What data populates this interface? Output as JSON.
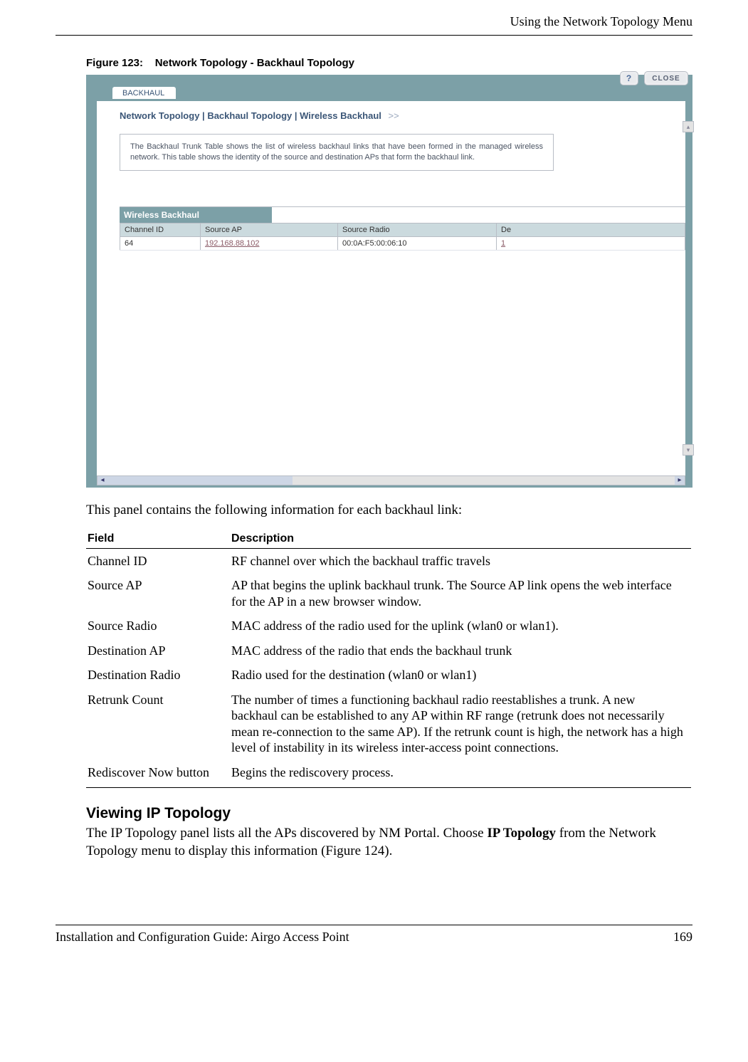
{
  "header": {
    "right_title": "Using the Network Topology Menu"
  },
  "figure": {
    "caption_label": "Figure 123:",
    "caption_text": "Network Topology - Backhaul Topology"
  },
  "screenshot": {
    "tab_label": "BACKHAUL",
    "help_label": "?",
    "close_label": "CLOSE",
    "breadcrumb_1": "Network Topology",
    "breadcrumb_2": "Backhaul Topology",
    "breadcrumb_3": "Wireless Backhaul",
    "breadcrumb_arrows": ">>",
    "intro_text": "The Backhaul Trunk Table shows the list of wireless backhaul links that have been formed in the managed wireless network. This table shows the identity of the source and destination APs that form the backhaul link.",
    "section_title": "Wireless Backhaul",
    "columns": {
      "c1": "Channel ID",
      "c2": "Source AP",
      "c3": "Source Radio",
      "c4": "De"
    },
    "row1": {
      "channel_id": "64",
      "source_ap": "192.168.88.102",
      "source_radio": "00:0A:F5:00:06:10",
      "dest_partial": "1"
    }
  },
  "panel_intro": "This panel contains the following information for each backhaul link:",
  "fields_header": {
    "field": "Field",
    "desc": "Description"
  },
  "fields": [
    {
      "name": "Channel ID",
      "desc": "RF channel over which the backhaul traffic travels"
    },
    {
      "name": "Source AP",
      "desc": "AP that begins the uplink backhaul trunk. The Source AP link opens the web interface for the AP in a new browser window."
    },
    {
      "name": "Source Radio",
      "desc": "MAC address of the radio used for the uplink (wlan0 or wlan1)."
    },
    {
      "name": "Destination AP",
      "desc": "MAC address of the radio that ends the backhaul trunk"
    },
    {
      "name": "Destination Radio",
      "desc": "Radio used for the destination (wlan0 or wlan1)"
    },
    {
      "name": "Retrunk Count",
      "desc": "The number of times a functioning backhaul radio reestablishes a trunk. A new backhaul can be established to any AP within RF range (retrunk does not necessarily mean re-connection to the same AP). If the retrunk count is high, the network has a high level of instability in its wireless inter-access point connections."
    },
    {
      "name": "Rediscover Now button",
      "desc": "Begins the rediscovery process."
    }
  ],
  "ip_section": {
    "heading": "Viewing IP Topology",
    "para_pre": "The IP Topology panel lists all the APs discovered by NM Portal. Choose ",
    "para_bold": "IP Topology",
    "para_post": " from the Network Topology menu to display this information (Figure 124)."
  },
  "footer": {
    "left": "Installation and Configuration Guide: Airgo Access Point",
    "right": "169"
  }
}
